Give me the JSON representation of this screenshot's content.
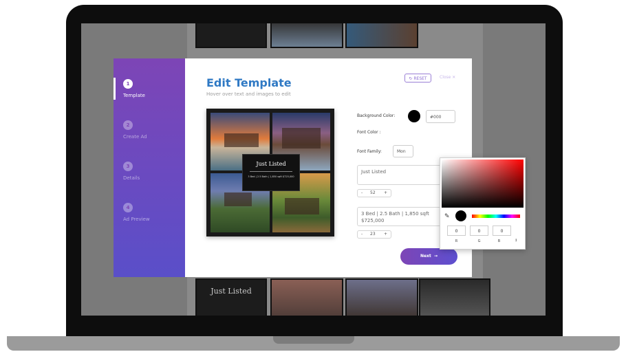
{
  "background_gallery": {
    "thumb_caption": "Just Listed"
  },
  "steps": [
    {
      "number": "1",
      "label": "Template",
      "active": true
    },
    {
      "number": "2",
      "label": "Create Ad",
      "active": false
    },
    {
      "number": "3",
      "label": "Details",
      "active": false
    },
    {
      "number": "4",
      "label": "Ad Preview",
      "active": false
    }
  ],
  "header": {
    "title": "Edit Template",
    "subtitle": "Hover over text and images to edit",
    "reset_label": "RESET",
    "close_label": "Close"
  },
  "preview": {
    "overlay_title": "Just Listed",
    "overlay_sub": "3 Bed | 2.5 Bath | 1,850 sqft $725,000"
  },
  "controls": {
    "background_color_label": "Background Color:",
    "background_color_hex": "#000",
    "font_color_label": "Font Color :",
    "font_family_label": "Font Family:",
    "font_family_value": "Mon",
    "text1_value": "Just Listed",
    "text1_size": "52",
    "text2_line1": "3 Bed | 2.5 Bath | 1,850 sqft",
    "text2_line2": "$725,000",
    "text2_size": "23",
    "next_label": "Next"
  },
  "color_picker": {
    "r": "0",
    "g": "0",
    "b": "0",
    "r_label": "R",
    "g_label": "G",
    "b_label": "B"
  },
  "colors": {
    "accent_purple": "#7d45b6",
    "title_blue": "#2f79c4"
  }
}
